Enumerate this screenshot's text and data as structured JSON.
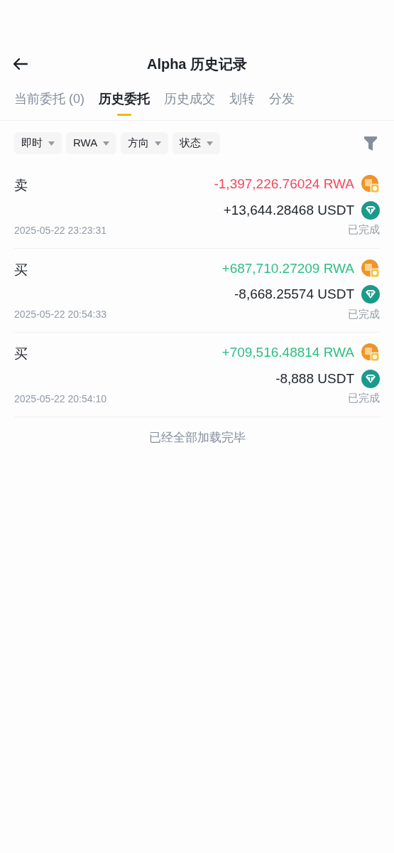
{
  "header": {
    "title": "Alpha 历史记录"
  },
  "tabs": [
    {
      "label": "当前委托 (0)",
      "selected": false
    },
    {
      "label": "历史委托",
      "selected": true
    },
    {
      "label": "历史成交",
      "selected": false
    },
    {
      "label": "划转",
      "selected": false
    },
    {
      "label": "分发",
      "selected": false
    }
  ],
  "filters": [
    "即时",
    "RWA",
    "方向",
    "状态"
  ],
  "orders": [
    {
      "side": "卖",
      "time": "2025-05-22 23:23:31",
      "status": "已完成",
      "amounts": [
        {
          "value": "-1,397,226.76024 RWA",
          "color": "#f6465d",
          "kind": "rwa"
        },
        {
          "value": "+13,644.28468 USDT",
          "color": "#1e2329",
          "kind": "usdt"
        }
      ]
    },
    {
      "side": "买",
      "time": "2025-05-22 20:54:33",
      "status": "已完成",
      "amounts": [
        {
          "value": "+687,710.27209 RWA",
          "color": "#2ebd85",
          "kind": "rwa"
        },
        {
          "value": "-8,668.25574 USDT",
          "color": "#1e2329",
          "kind": "usdt"
        }
      ]
    },
    {
      "side": "买",
      "time": "2025-05-22 20:54:10",
      "status": "已完成",
      "amounts": [
        {
          "value": "+709,516.48814 RWA",
          "color": "#2ebd85",
          "kind": "rwa"
        },
        {
          "value": "-8,888 USDT",
          "color": "#1e2329",
          "kind": "usdt"
        }
      ]
    }
  ],
  "footer": "已经全部加载完毕"
}
